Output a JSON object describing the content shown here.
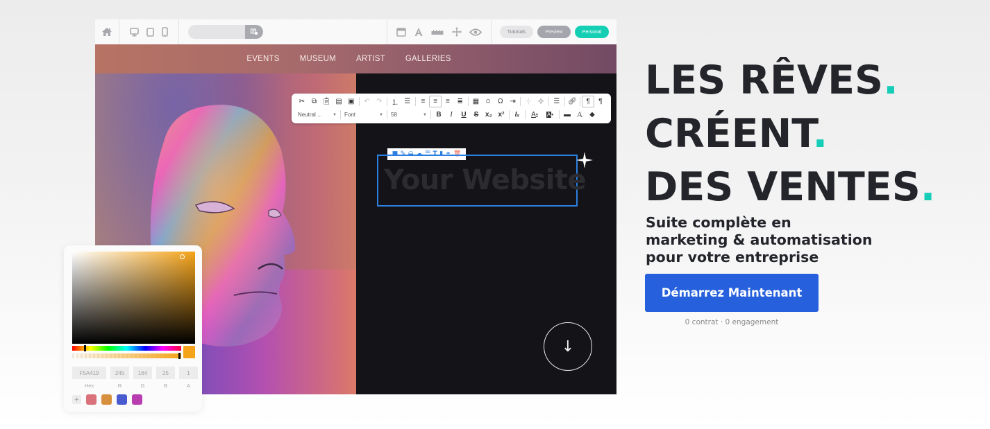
{
  "builder": {
    "topbar": {
      "icons_left": [
        "home-icon",
        "desktop-icon",
        "tablet-icon",
        "mobile-icon"
      ],
      "search": {
        "value": "",
        "placeholder": ""
      },
      "search_button_icon": "template-settings-icon",
      "tool_icons": [
        "layout-icon",
        "typography-icon",
        "ruler-icon",
        "move-icon",
        "preview-eye-icon"
      ],
      "buttons": {
        "tutorials": "Tutorials",
        "preview": "Preview",
        "personal": "Personal"
      }
    },
    "site_nav": [
      "EVENTS",
      "MUSEUM",
      "ARTIST",
      "GALLERIES"
    ],
    "rich_text_toolbar": {
      "row1_icons": [
        "cut",
        "copy",
        "paste",
        "paste-text",
        "paste-word",
        "undo",
        "redo",
        "numbered-list",
        "bulleted-list",
        "align-left",
        "align-center",
        "align-right",
        "justify",
        "table",
        "emoji",
        "special-char",
        "indent",
        "horizontal-line-a",
        "horizontal-line-b",
        "page-break",
        "link",
        "ltr",
        "rtl"
      ],
      "style_select": "Neutral ...",
      "font_select": "Font",
      "size_select": "58",
      "row2_buttons": [
        "B",
        "I",
        "U",
        "S",
        "x₂",
        "x²",
        "Iₓ",
        "A",
        "A"
      ]
    },
    "selected_element": {
      "text": "Your Website",
      "toolbar_icons": [
        "edit-box",
        "pencil",
        "layers",
        "cloud",
        "align",
        "text",
        "copy",
        "link",
        "delete"
      ]
    },
    "scroll_down_icon": "arrow-down-icon"
  },
  "color_picker": {
    "hex": "F5A419",
    "r": "245",
    "g": "164",
    "b": "25",
    "a": "1",
    "labels": {
      "hex": "Hex",
      "r": "R",
      "g": "G",
      "b": "B",
      "a": "A"
    },
    "current_color": "#f5a419",
    "add_label": "+",
    "presets": [
      "#d9727a",
      "#d7913e",
      "#4a5bd0",
      "#b83db0"
    ]
  },
  "marketing": {
    "headline": [
      {
        "text": "LES RÊVES",
        "dot": "."
      },
      {
        "text": "CRÉENT",
        "dot": "."
      },
      {
        "text": "DES VENTES",
        "dot": "."
      }
    ],
    "subline": [
      "Suite complète en",
      "marketing & automatisation",
      "pour votre entreprise"
    ],
    "cta_label": "Démarrez Maintenant",
    "cta_note": "0 contrat · 0 engagement",
    "accent_color": "#16cdb8",
    "cta_color": "#2660dd"
  }
}
